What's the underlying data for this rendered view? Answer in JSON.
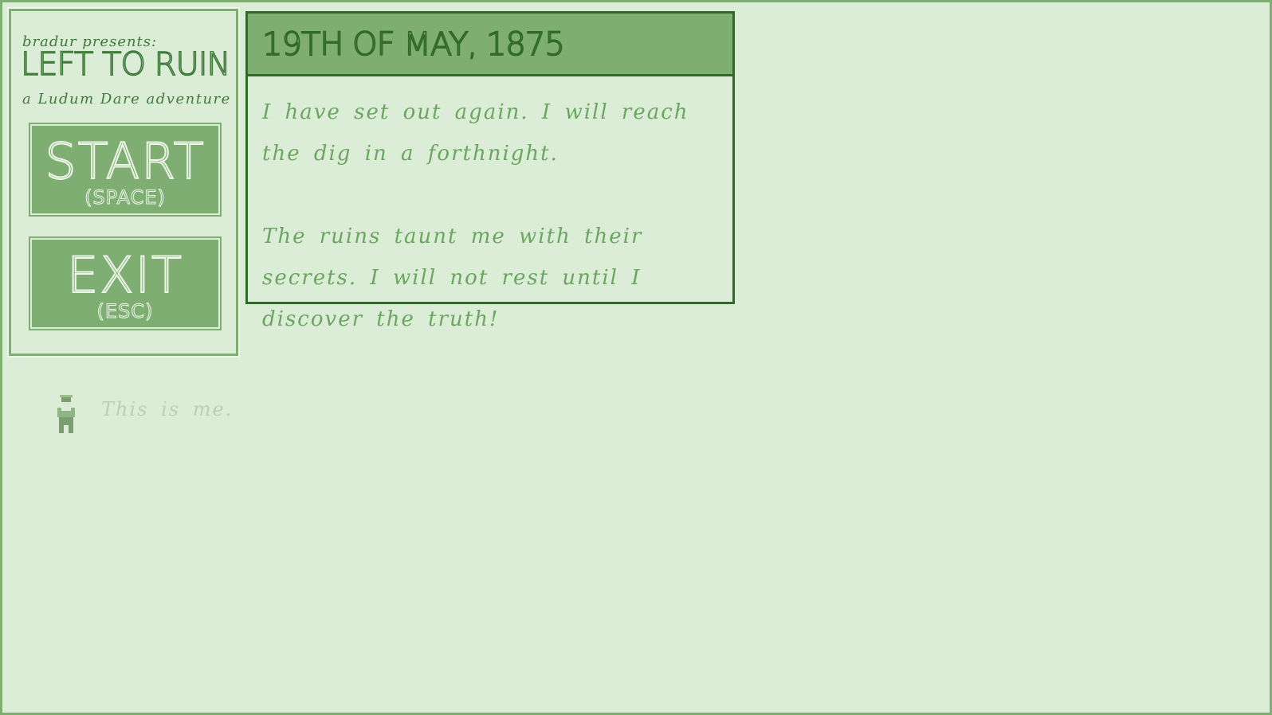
{
  "menu": {
    "presents": "bradur presents:",
    "game_title": "LEFT TO RUIN",
    "subtitle": "a Ludum Dare adventure",
    "start": {
      "label": "START",
      "key": "(SPACE)"
    },
    "exit": {
      "label": "EXIT",
      "key": "(ESC)"
    }
  },
  "journal": {
    "date": "19TH OF MAY, 1875",
    "paragraphs": [
      "I have set out again. I will reach the dig in a forthnight.",
      "The ruins taunt me with their secrets. I will not rest until I discover the truth!"
    ]
  },
  "player": {
    "hint": "This is me."
  },
  "colors": {
    "background": "#dcedd7",
    "panel_green": "#7fae72",
    "dark_green": "#2f6a2b",
    "text_green": "#6ba660"
  }
}
